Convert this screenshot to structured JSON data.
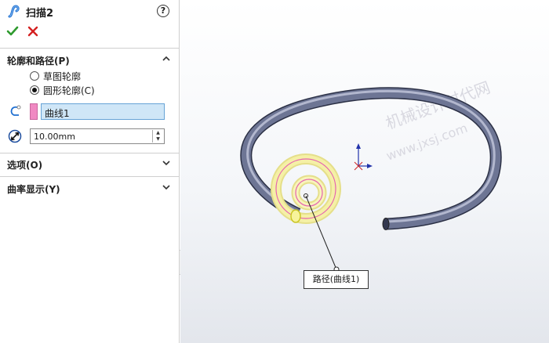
{
  "property_manager": {
    "feature_title": "扫描2",
    "feature_icon": "sweep-icon",
    "ok_icon": "checkmark-icon",
    "cancel_icon": "x-icon",
    "help_icon": "help-circle-icon",
    "help_text": "?",
    "sections": {
      "profile_path": {
        "label": "轮廓和路径(P)",
        "options": [
          {
            "label": "草图轮廓",
            "selected": false
          },
          {
            "label": "圆形轮廓(C)",
            "selected": true
          }
        ],
        "path_value": "曲线1",
        "path_swatch_color": "#f089c2",
        "diameter_value": "10.00mm"
      },
      "options": {
        "label": "选项(O)"
      },
      "curvature": {
        "label": "曲率显示(Y)"
      }
    }
  },
  "viewport": {
    "callout_text": "路径(曲线1)",
    "watermark_line1": "机械设计时代网",
    "watermark_line2": "www.jxsj.com",
    "triad_colors": {
      "axis": "#2233aa",
      "marker": "#cc2222"
    },
    "sweep_color": "#5d6584",
    "selection_color": "#f5f0a6"
  }
}
